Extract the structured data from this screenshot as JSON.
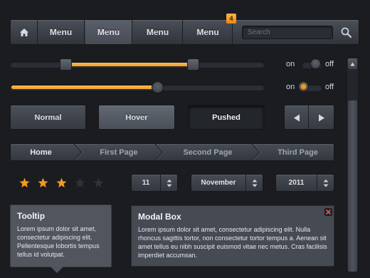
{
  "navbar": {
    "items": [
      "Menu",
      "Menu",
      "Menu",
      "Menu"
    ],
    "active_index": 1,
    "badge": "4",
    "search_placeholder": "Search",
    "icons": {
      "home": "home-icon",
      "search": "search-icon"
    }
  },
  "sliders": [
    {
      "type": "range",
      "range": [
        0.22,
        0.72
      ]
    },
    {
      "type": "single",
      "value": 0.58
    }
  ],
  "toggles": [
    {
      "on_label": "on",
      "off_label": "off",
      "state": "off"
    },
    {
      "on_label": "on",
      "off_label": "off",
      "state": "on"
    }
  ],
  "buttons": {
    "normal": "Normal",
    "hover": "Hover",
    "pushed": "Pushed",
    "icons": {
      "prev": "triangle-left-icon",
      "next": "triangle-right-icon"
    }
  },
  "breadcrumb": [
    "Home",
    "First Page",
    "Second Page",
    "Third Page"
  ],
  "rating": {
    "value": 3,
    "max": 5
  },
  "date_picker": {
    "day": "11",
    "month": "November",
    "year": "2011"
  },
  "tooltip": {
    "title": "Tooltip",
    "body": "Lorem ipsum dolor sit amet, consectetur adipiscing elit. Pellentesque lobortis tempus tellus id volutpat."
  },
  "modal": {
    "title": "Modal Box",
    "body": "Lorem ipsum dolor sit amet, consectetur adipiscing elit. Nulla rhoncus sagittis tortor, non consectetur tortor tempus a. Aenean sit amet tellus eu nibh suscipit euismod vitae nec metus. Cras facilisis imperdiet accumsan."
  },
  "colors": {
    "accent": "#f29a1f",
    "background": "#1a1c20",
    "panel": "#454a53",
    "star_empty": "#2f3238"
  }
}
